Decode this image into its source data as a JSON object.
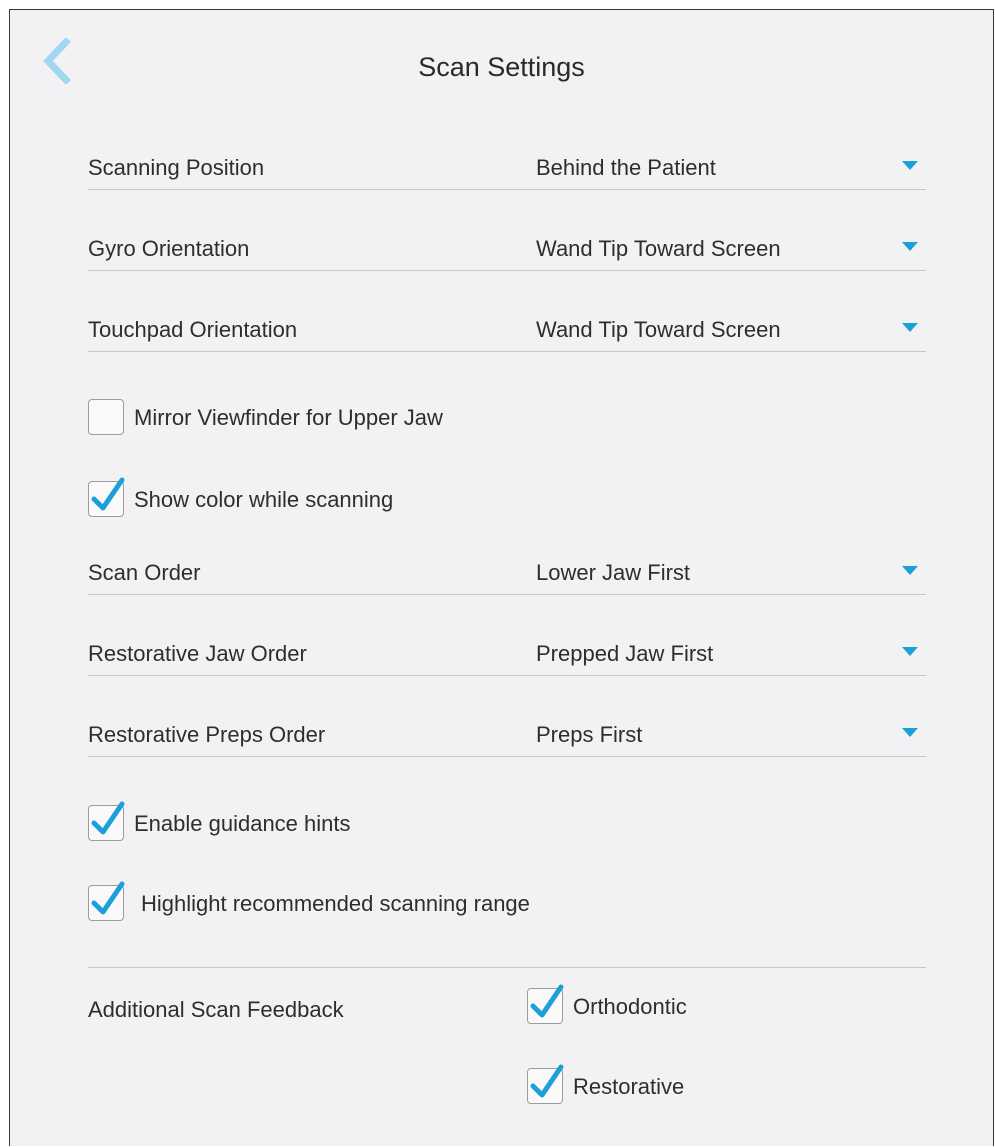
{
  "header": {
    "title": "Scan Settings",
    "back_icon": "chevron-left-icon",
    "accent_color": "#1d9fdc"
  },
  "settings": {
    "scanning_position": {
      "label": "Scanning Position",
      "value": "Behind the Patient"
    },
    "gyro_orientation": {
      "label": "Gyro Orientation",
      "value": "Wand Tip Toward Screen"
    },
    "touchpad_orientation": {
      "label": "Touchpad Orientation",
      "value": "Wand Tip Toward Screen"
    },
    "mirror_viewfinder": {
      "label": "Mirror Viewfinder for Upper Jaw",
      "checked": false
    },
    "show_color": {
      "label": "Show color while scanning",
      "checked": true
    },
    "scan_order": {
      "label": "Scan Order",
      "value": "Lower Jaw First"
    },
    "restorative_jaw_order": {
      "label": "Restorative Jaw Order",
      "value": "Prepped Jaw First"
    },
    "restorative_preps_order": {
      "label": "Restorative Preps Order",
      "value": "Preps First"
    },
    "guidance_hints": {
      "label": "Enable guidance hints",
      "checked": true
    },
    "highlight_range": {
      "label": "Highlight recommended scanning range",
      "checked": true
    }
  },
  "additional_feedback": {
    "label": "Additional Scan Feedback",
    "options": [
      {
        "label": "Orthodontic",
        "checked": true
      },
      {
        "label": "Restorative",
        "checked": true
      }
    ]
  }
}
